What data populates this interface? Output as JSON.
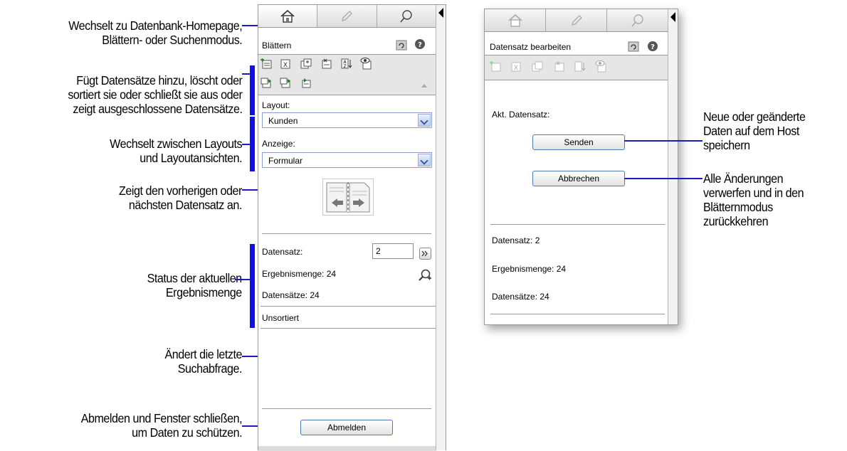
{
  "callouts": {
    "home": [
      "Wechselt zu Datenbank-Homepage,",
      "Blättern- oder Suchenmodus."
    ],
    "records": [
      "Fügt Datensätze hinzu, löscht oder",
      "sortiert sie oder schließt sie aus oder",
      "zeigt ausgeschlossene Datensätze."
    ],
    "layouts": [
      "Wechselt zwischen Layouts",
      "und Layoutansichten."
    ],
    "navigate": [
      "Zeigt den vorherigen oder",
      "nächsten Datensatz an."
    ],
    "status": [
      "Status der aktuellen",
      "Ergebnismenge"
    ],
    "find": [
      "Ändert die letzte",
      "Suchabfrage."
    ],
    "logout": [
      "Abmelden und Fenster schließen,",
      "um Daten zu schützen."
    ],
    "submit": [
      "Neue oder geänderte",
      "Daten auf dem Host",
      "speichern"
    ],
    "cancel": [
      "Alle Änderungen",
      "verwerfen und in den",
      "Blätternmodus",
      "zurückkehren"
    ]
  },
  "browse_panel": {
    "mode_title": "Blättern",
    "layout_label": "Layout:",
    "layout_value": "Kunden",
    "view_label": "Anzeige:",
    "view_value": "Formular",
    "record_label": "Datensatz:",
    "record_value": "2",
    "found_set": "Ergebnismenge: 24",
    "total_records": "Datensätze: 24",
    "sort_status": "Unsortiert",
    "logout_button": "Abmelden"
  },
  "edit_panel": {
    "mode_title": "Datensatz bearbeiten",
    "current_record": "Akt. Datensatz:",
    "submit_button": "Senden",
    "cancel_button": "Abbrechen",
    "record": "Datensatz: 2",
    "found_set": "Ergebnismenge: 24",
    "total_records": "Datensätze: 24"
  },
  "icons": [
    "home-icon",
    "pencil-icon",
    "search-icon",
    "refresh-icon",
    "help-icon",
    "new-record-icon",
    "delete-record-icon",
    "duplicate-record-icon",
    "omit-record-icon",
    "sort-icon",
    "show-all-icon",
    "show-omitted-icon",
    "omit-multiple-icon",
    "modify-find-icon",
    "book-navigation-icon",
    "next-icon"
  ],
  "colors": {
    "callout_line": "#1d1dbf",
    "callout_bar": "#1010e8",
    "button_border": "#4d7ab3"
  }
}
